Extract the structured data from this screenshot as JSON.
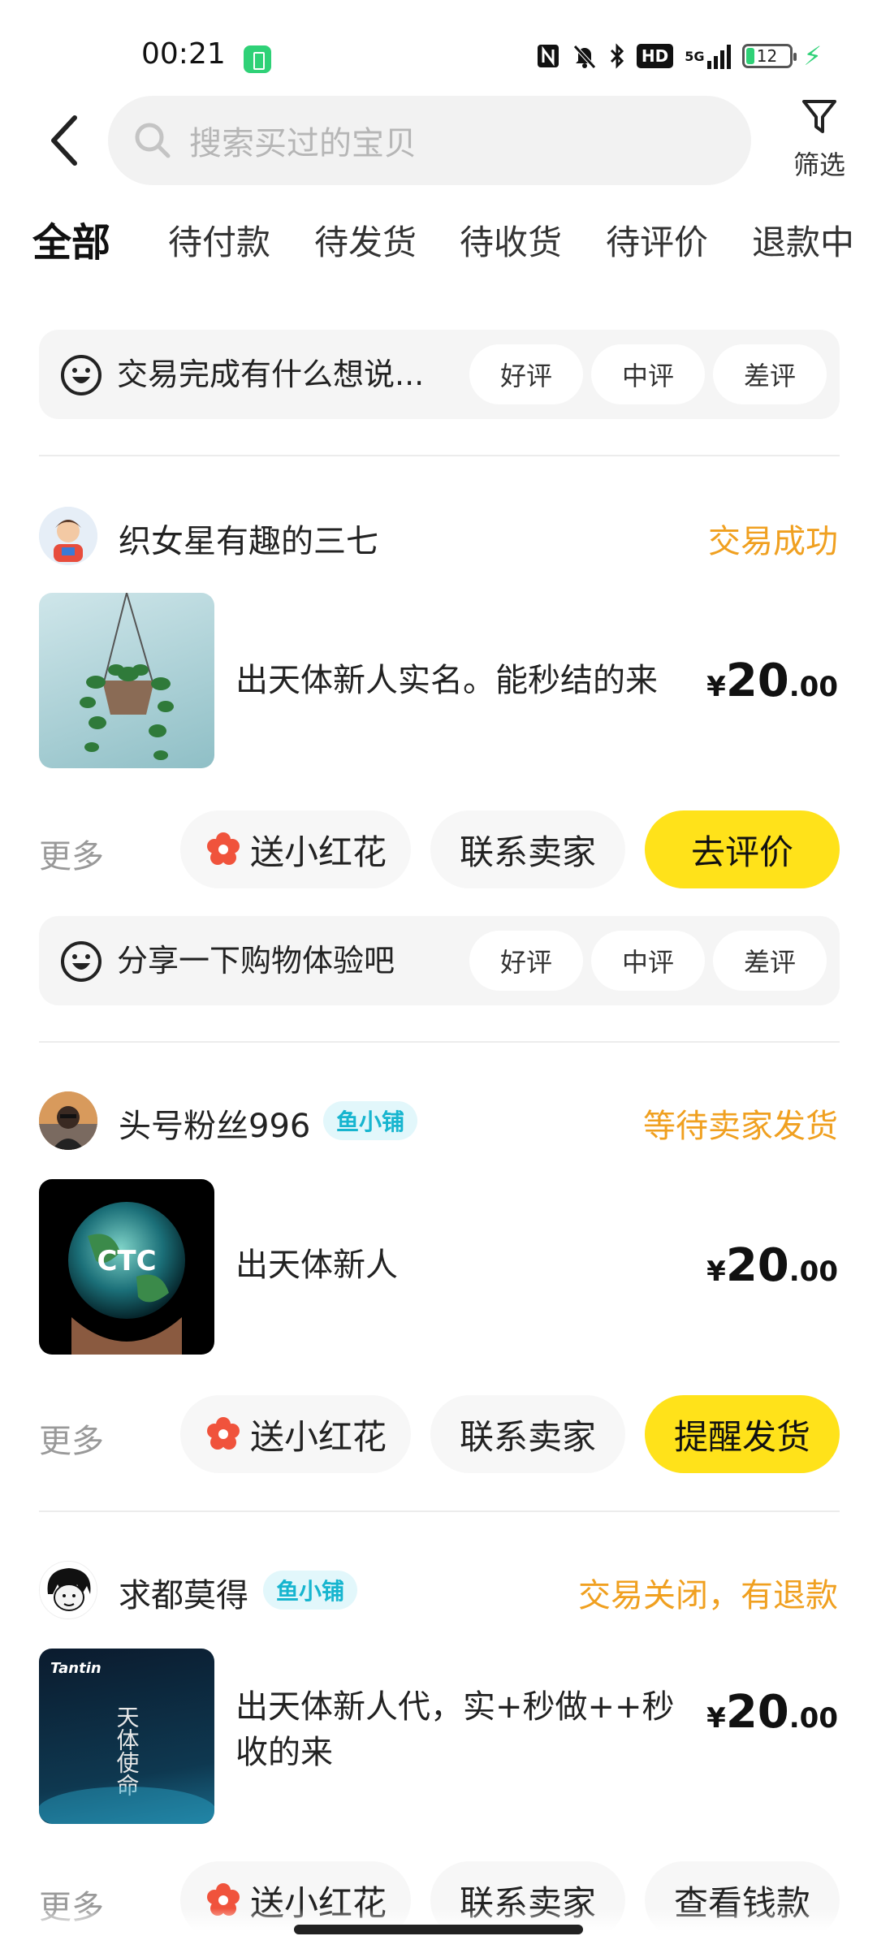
{
  "status_bar": {
    "time": "00:21",
    "battery_level": "12"
  },
  "header": {
    "search_placeholder": "搜索买过的宝贝",
    "filter_label": "筛选"
  },
  "tabs": [
    {
      "label": "全部",
      "active": true
    },
    {
      "label": "待付款",
      "active": false
    },
    {
      "label": "待发货",
      "active": false
    },
    {
      "label": "待收货",
      "active": false
    },
    {
      "label": "待评价",
      "active": false
    },
    {
      "label": "退款中",
      "active": false
    }
  ],
  "top_review_prompt": {
    "text": "交易完成有什么想说...",
    "ratings": [
      "好评",
      "中评",
      "差评"
    ]
  },
  "orders": [
    {
      "seller": "织女星有趣的三七",
      "status": "交易成功",
      "title": "出天体新人实名。能秒结的来",
      "price_currency": "¥",
      "price_int": "20",
      "price_dec": ".00",
      "more": "更多",
      "flower": "送小红花",
      "contact": "联系卖家",
      "action": "去评价",
      "review_prompt": {
        "text": "分享一下购物体验吧",
        "ratings": [
          "好评",
          "中评",
          "差评"
        ]
      }
    },
    {
      "seller": "头号粉丝996",
      "badge": "鱼小铺",
      "status": "等待卖家发货",
      "title": "出天体新人",
      "image_text": "CTC",
      "price_currency": "¥",
      "price_int": "20",
      "price_dec": ".00",
      "more": "更多",
      "flower": "送小红花",
      "contact": "联系卖家",
      "action": "提醒发货"
    },
    {
      "seller": "求都莫得",
      "badge": "鱼小铺",
      "status": "交易关闭，有退款",
      "title": "出天体新人代，实+秒做++秒收的来",
      "image_brand": "Tantin",
      "image_text": "天体使命",
      "price_currency": "¥",
      "price_int": "20",
      "price_dec": ".00",
      "more": "更多",
      "flower": "送小红花",
      "contact": "联系卖家",
      "action": "查看钱款"
    }
  ],
  "colors": {
    "accent_yellow": "#ffe21a",
    "status_orange": "#f0a020",
    "badge_cyan": "#17b5cf"
  }
}
